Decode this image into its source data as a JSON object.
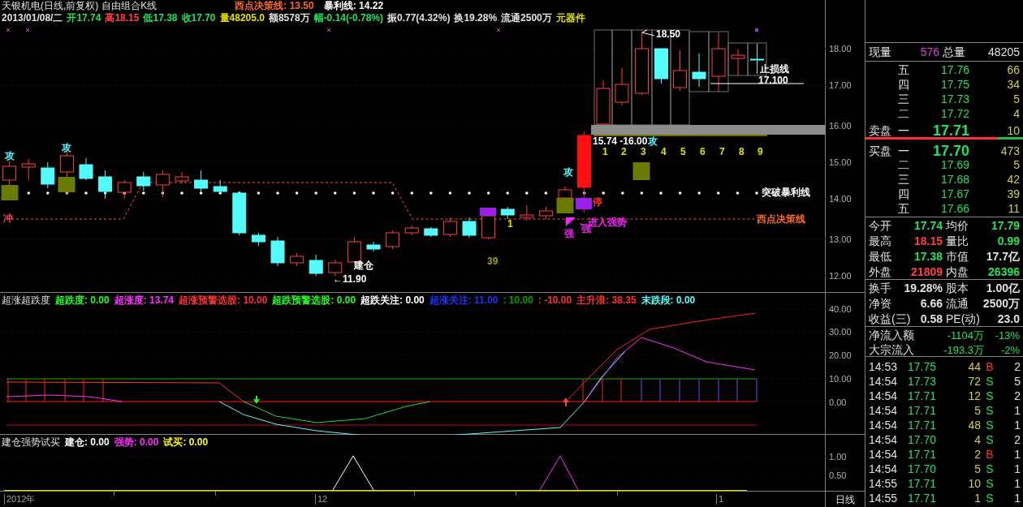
{
  "header": {
    "title": "天银机电(日线,前复权)",
    "formula": "自由组合K线",
    "lines": [
      {
        "text": "西点决策线: 13.50",
        "color": "#ff6a2a"
      },
      {
        "text": "暴利线: 14.22",
        "color": "#ffffff"
      }
    ],
    "quote": [
      {
        "text": "2013/01/08/二",
        "color": "#e0e0e0"
      },
      {
        "text": "开17.74",
        "color": "#20e060"
      },
      {
        "text": "高18.15",
        "color": "#ff4040"
      },
      {
        "text": "低17.38",
        "color": "#20e060"
      },
      {
        "text": "收17.70",
        "color": "#20e060"
      },
      {
        "text": "量48205.0",
        "color": "#e0e000"
      },
      {
        "text": "额8578万",
        "color": "#e0e0e0"
      },
      {
        "text": "幅-0.14(-0.78%)",
        "color": "#20e060"
      },
      {
        "text": "振0.77(4.32%)",
        "color": "#e0e0e0"
      },
      {
        "text": "换19.28%",
        "color": "#e0e0e0"
      },
      {
        "text": "流通2500万",
        "color": "#e0e0e0"
      },
      {
        "text": "元器件",
        "color": "#e0e000"
      }
    ]
  },
  "price_chart": {
    "annotations": [
      {
        "text": "攻",
        "color": "#54fcfc"
      },
      {
        "text": "攻",
        "color": "#54fcfc"
      },
      {
        "text": "冲",
        "color": "#ff4060"
      },
      {
        "text": "←11.90",
        "color": "#ffffff"
      },
      {
        "text": "建仓",
        "color": "#ffffff"
      },
      {
        "text": "39",
        "color": "#a0a000"
      },
      {
        "text": "1",
        "color": "#e0e000"
      },
      {
        "text": "攻",
        "color": "#54fcfc"
      },
      {
        "text": "停",
        "color": "#ff3030"
      },
      {
        "text": "←进入强势",
        "color": "#ff20ff"
      },
      {
        "text": "强",
        "color": "#ff20ff"
      },
      {
        "text": "强",
        "color": "#ff20ff"
      },
      {
        "text": "突破暴利线",
        "color": "#ffffff"
      },
      {
        "text": "西点决策线",
        "color": "#ff6a2a"
      },
      {
        "text": "18.50",
        "color": "#ffffff"
      },
      {
        "text": "止损线",
        "color": "#ffffff"
      },
      {
        "text": "17.100",
        "color": "#ffffff"
      },
      {
        "text": "15.74 -16.00",
        "color": "#ffffff"
      },
      {
        "text": "攻",
        "color": "#54fcfc"
      },
      {
        "text": "1",
        "color": "#e0e000"
      },
      {
        "text": "2",
        "color": "#e0e000"
      },
      {
        "text": "3",
        "color": "#e0e000"
      },
      {
        "text": "4",
        "color": "#e0e000"
      },
      {
        "text": "5",
        "color": "#e0e000"
      },
      {
        "text": "6",
        "color": "#e0e000"
      },
      {
        "text": "7",
        "color": "#e0e000"
      },
      {
        "text": "8",
        "color": "#e0e000"
      },
      {
        "text": "9",
        "color": "#e0e000"
      }
    ],
    "axis": [
      "18.00",
      "17.00",
      "16.00",
      "15.00",
      "14.00",
      "13.00",
      "12.00"
    ]
  },
  "indicator": {
    "title": "超涨超跌度",
    "items": [
      {
        "text": "超跌度: 0.00",
        "color": "#20ff20"
      },
      {
        "text": "超涨度: 13.74",
        "color": "#ff30ff"
      },
      {
        "text": "超涨预警选股: 10.00",
        "color": "#ff3030"
      },
      {
        "text": "超跌预警选股: 0.00",
        "color": "#20ff20"
      },
      {
        "text": "超跌关注: 0.00",
        "color": "#ffffff"
      },
      {
        "text": "超涨关注: 11.00",
        "color": "#2030ff"
      },
      {
        "text": ": 10.00",
        "color": "#00a000"
      },
      {
        "text": ": -10.00",
        "color": "#ff3030"
      },
      {
        "text": "主升浪: 38.35",
        "color": "#ff3030"
      },
      {
        "text": "末跌段: 0.00",
        "color": "#54fcfc"
      }
    ],
    "axis": [
      "40.00",
      "30.00",
      "20.00",
      "10.00",
      "0.00"
    ]
  },
  "signal_panel": {
    "title": "建仓强势试买",
    "items": [
      {
        "text": "建仓: 0.00",
        "color": "#ffffff"
      },
      {
        "text": "强势: 0.00",
        "color": "#ff30ff"
      },
      {
        "text": "试买: 0.00",
        "color": "#ffff00"
      }
    ],
    "axis": [
      "1.00",
      "0.50"
    ]
  },
  "date_axis": {
    "labels": [
      "2012年",
      "12",
      "1"
    ],
    "period": "日线"
  },
  "quote_panel": {
    "current_volume": {
      "label": "现量",
      "value": "576"
    },
    "total_volume": {
      "label": "总量",
      "value": "48205"
    },
    "asks": {
      "label": "卖盘",
      "rows": [
        {
          "level": "五",
          "price": "17.76",
          "volume": "66"
        },
        {
          "level": "四",
          "price": "17.75",
          "volume": "34"
        },
        {
          "level": "三",
          "price": "17.73",
          "volume": "5"
        },
        {
          "level": "二",
          "price": "17.72",
          "volume": "4"
        },
        {
          "level": "一",
          "price": "17.71",
          "volume": "10"
        }
      ]
    },
    "ratio": {
      "level": 0.84
    },
    "bids": {
      "label": "买盘",
      "rows": [
        {
          "level": "一",
          "price": "17.70",
          "volume": "473"
        },
        {
          "level": "二",
          "price": "17.69",
          "volume": "5"
        },
        {
          "level": "三",
          "price": "17.68",
          "volume": "42"
        },
        {
          "level": "四",
          "price": "17.67",
          "volume": "39"
        },
        {
          "level": "五",
          "price": "17.66",
          "volume": "11"
        }
      ]
    },
    "stats": [
      {
        "label": "今开",
        "value": "17.74",
        "color": "#20e060"
      },
      {
        "label": "均价",
        "value": "17.79",
        "color": "#20e060"
      },
      {
        "label": "最高",
        "value": "18.15",
        "color": "#ff4040"
      },
      {
        "label": "量比",
        "value": "0.99",
        "color": "#20e060"
      },
      {
        "label": "最低",
        "value": "17.38",
        "color": "#20e060"
      },
      {
        "label": "市值",
        "value": "17.7亿",
        "color": "#e0e0e0"
      },
      {
        "label": "外盘",
        "value": "21809",
        "color": "#ff4040"
      },
      {
        "label": "内盘",
        "value": "26396",
        "color": "#20e060"
      },
      {
        "label": "换手",
        "value": "19.28%",
        "color": "#e0e0e0"
      },
      {
        "label": "股本",
        "value": "1.00亿",
        "color": "#e0e0e0"
      },
      {
        "label": "净资",
        "value": "6.66",
        "color": "#e0e0e0"
      },
      {
        "label": "流通",
        "value": "2500万",
        "color": "#e0e0e0"
      },
      {
        "label": "收益(三)",
        "value": "0.58",
        "color": "#e0e0e0"
      },
      {
        "label": "PE(动)",
        "value": "23.0",
        "color": "#e0e0e0"
      }
    ],
    "flows": [
      {
        "label": "净流入额",
        "value": "-1104万",
        "percent": "-13%"
      },
      {
        "label": "大宗流入",
        "value": "-193.3万",
        "percent": "-2%"
      }
    ],
    "ticks": [
      {
        "time": "14:53",
        "price": "17.75",
        "volume": "44",
        "side": "B",
        "kind": "buy",
        "count": "2"
      },
      {
        "time": "14:54",
        "price": "17.73",
        "volume": "72",
        "side": "S",
        "kind": "sell",
        "count": "5"
      },
      {
        "time": "14:54",
        "price": "17.71",
        "volume": "12",
        "side": "S",
        "kind": "sell",
        "count": "2"
      },
      {
        "time": "14:54",
        "price": "17.71",
        "volume": "5",
        "side": "S",
        "kind": "sell",
        "count": "1"
      },
      {
        "time": "14:54",
        "price": "17.71",
        "volume": "48",
        "side": "S",
        "kind": "sell",
        "count": "1"
      },
      {
        "time": "14:54",
        "price": "17.70",
        "volume": "4",
        "side": "S",
        "kind": "sell",
        "count": "2"
      },
      {
        "time": "14:54",
        "price": "17.71",
        "volume": "2",
        "side": "B",
        "kind": "buy",
        "count": "1"
      },
      {
        "time": "14:54",
        "price": "17.70",
        "volume": "5",
        "side": "S",
        "kind": "sell",
        "count": "1"
      },
      {
        "time": "14:55",
        "price": "17.71",
        "volume": "10",
        "side": "S",
        "kind": "sell",
        "count": "1"
      },
      {
        "time": "14:55",
        "price": "17.71",
        "volume": "1",
        "side": "S",
        "kind": "sell",
        "count": "1"
      }
    ]
  }
}
